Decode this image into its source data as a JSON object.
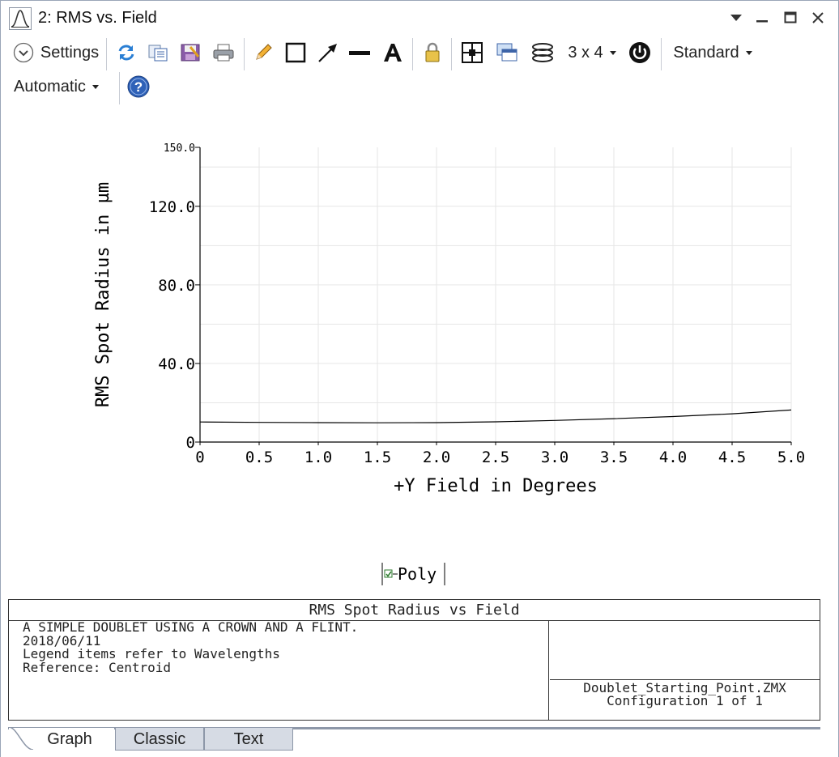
{
  "window": {
    "title": "2: RMS vs. Field"
  },
  "toolbar": {
    "settings_label": "Settings",
    "layout_label": "3 x 4",
    "standard_label": "Standard",
    "automatic_label": "Automatic",
    "icons": [
      "refresh-icon",
      "copy-icon",
      "save-icon",
      "print-icon",
      "pencil-icon",
      "rectangle-icon",
      "arrow-icon",
      "line-icon",
      "text-icon",
      "lock-icon",
      "layout-grid-icon",
      "window-stack-icon",
      "layers-icon",
      "power-icon",
      "help-icon"
    ]
  },
  "chart_data": {
    "type": "line",
    "xlabel": "+Y Field in Degrees",
    "ylabel": "RMS Spot Radius in µm",
    "xlim": [
      0,
      5.0
    ],
    "ylim": [
      0,
      150.0
    ],
    "x_ticks": [
      "0",
      "0.5",
      "1.0",
      "1.5",
      "2.0",
      "2.5",
      "3.0",
      "3.5",
      "4.0",
      "4.5",
      "5.0"
    ],
    "y_ticks": [
      "0",
      "40.0",
      "80.0",
      "120.0",
      "150.0"
    ],
    "grid": true,
    "legend_position": "bottom-center",
    "series": [
      {
        "name": "Poly",
        "color": "#000000",
        "x": [
          0,
          0.5,
          1.0,
          1.5,
          2.0,
          2.5,
          3.0,
          3.5,
          4.0,
          4.5,
          5.0
        ],
        "y": [
          10.2,
          10.0,
          9.9,
          9.8,
          9.9,
          10.3,
          11.0,
          11.9,
          13.0,
          14.4,
          16.3
        ]
      }
    ]
  },
  "legend": {
    "items": [
      {
        "label": "Poly",
        "checked": true
      }
    ]
  },
  "info": {
    "title": "RMS Spot Radius vs Field",
    "lines": [
      "A SIMPLE DOUBLET USING A CROWN AND A FLINT.",
      "2018/06/11",
      "Legend items refer to Wavelengths",
      "Reference: Centroid"
    ],
    "file": "Doublet_Starting_Point.ZMX",
    "configuration": "Configuration 1 of 1"
  },
  "tabs": [
    {
      "label": "Graph",
      "active": true
    },
    {
      "label": "Classic",
      "active": false
    },
    {
      "label": "Text",
      "active": false
    }
  ]
}
